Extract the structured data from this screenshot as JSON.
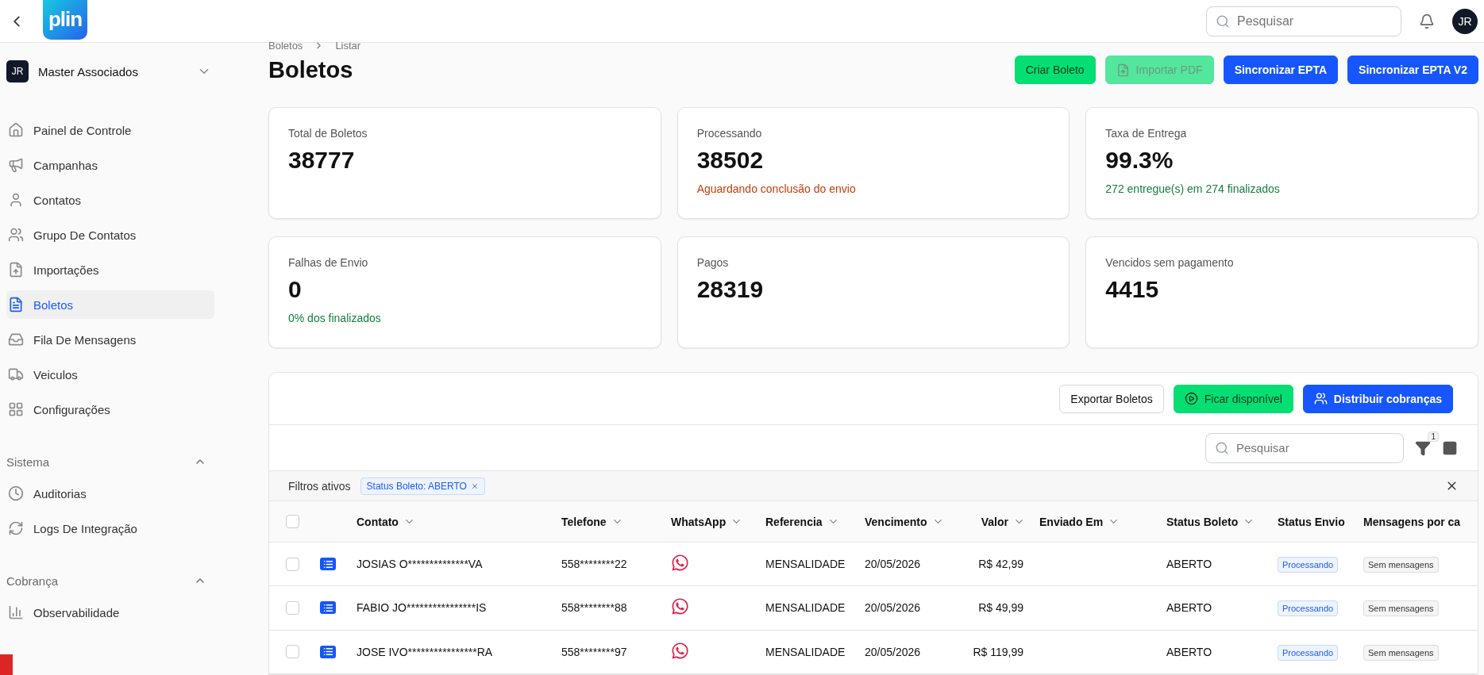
{
  "header": {
    "logo": "plin",
    "search": {
      "placeholder": "Pesquisar"
    },
    "avatar": "JR"
  },
  "sidebar": {
    "org": {
      "initials": "JR",
      "name": "Master Associados"
    },
    "items": [
      {
        "label": "Painel de Controle",
        "selected": false
      },
      {
        "label": "Campanhas",
        "selected": false
      },
      {
        "label": "Contatos",
        "selected": false
      },
      {
        "label": "Grupo De Contatos",
        "selected": false
      },
      {
        "label": "Importações",
        "selected": false
      },
      {
        "label": "Boletos",
        "selected": true
      },
      {
        "label": "Fila De Mensagens",
        "selected": false
      },
      {
        "label": "Veiculos",
        "selected": false
      },
      {
        "label": "Configurações",
        "selected": false
      }
    ],
    "sections": [
      {
        "title": "Sistema",
        "expanded": true,
        "items": [
          {
            "label": "Auditorias",
            "selected": false
          },
          {
            "label": "Logs De Integração",
            "selected": false
          }
        ]
      },
      {
        "title": "Cobrança",
        "expanded": true,
        "items": [
          {
            "label": "Observabilidade",
            "selected": false
          }
        ]
      }
    ]
  },
  "page": {
    "breadcrumb": [
      "Boletos",
      "Listar"
    ],
    "title": "Boletos",
    "actions": [
      {
        "label": "Criar Boleto",
        "kind": "green",
        "disabled": false
      },
      {
        "label": "Importar PDF",
        "kind": "green",
        "disabled": true
      },
      {
        "label": "Sincronizar EPTA",
        "kind": "blue",
        "disabled": false
      },
      {
        "label": "Sincronizar EPTA V2",
        "kind": "blue",
        "disabled": false
      }
    ]
  },
  "stats": [
    {
      "label": "Total de Boletos",
      "value": "38777"
    },
    {
      "label": "Processando",
      "value": "38502",
      "note": "Aguardando conclusão do envio",
      "kind": "warning"
    },
    {
      "label": "Taxa de Entrega",
      "value": "99.3%",
      "note": "272 entregue(s) em 274 finalizados",
      "kind": "success"
    },
    {
      "label": "Falhas de Envio",
      "value": "0",
      "note": "0% dos finalizados",
      "kind": "success"
    },
    {
      "label": "Pagos",
      "value": "28319"
    },
    {
      "label": "Vencidos sem pagamento",
      "value": "4415"
    }
  ],
  "table": {
    "actions": [
      {
        "label": "Exportar Boletos",
        "kind": "outline"
      },
      {
        "label": "Ficar disponível",
        "kind": "green"
      },
      {
        "label": "Distribuir cobranças",
        "kind": "blue"
      }
    ],
    "search": {
      "placeholder": "Pesquisar"
    },
    "filter_count": "1",
    "active_filters": {
      "label": "Filtros ativos",
      "chips": [
        "Status Boleto: ABERTO"
      ]
    },
    "select_all": {
      "checked": false
    },
    "columns": [
      {
        "label": "Contato",
        "sortable": true
      },
      {
        "label": "Telefone",
        "sortable": true
      },
      {
        "label": "WhatsApp",
        "sortable": true
      },
      {
        "label": "Referencia",
        "sortable": true
      },
      {
        "label": "Vencimento",
        "sortable": true
      },
      {
        "label": "Valor",
        "sortable": true
      },
      {
        "label": "Enviado Em",
        "sortable": true
      },
      {
        "label": "Status Boleto",
        "sortable": true
      },
      {
        "label": "Status Envio",
        "sortable": false
      },
      {
        "label": "Mensagens por ca",
        "sortable": false
      }
    ],
    "rows": [
      {
        "checked": false,
        "contato": "JOSIAS O**************VA",
        "telefone": "558********22",
        "referencia": "MENSALIDADE",
        "vencimento": "20/05/2026",
        "valor": "R$ 42,99",
        "status_boleto": "ABERTO",
        "status_envio": "Processando",
        "mensagens": "Sem mensagens"
      },
      {
        "checked": false,
        "contato": "FABIO JO****************IS",
        "telefone": "558********88",
        "referencia": "MENSALIDADE",
        "vencimento": "20/05/2026",
        "valor": "R$ 49,99",
        "status_boleto": "ABERTO",
        "status_envio": "Processando",
        "mensagens": "Sem mensagens"
      },
      {
        "checked": false,
        "contato": "JOSE IVO****************RA",
        "telefone": "558********97",
        "referencia": "MENSALIDADE",
        "vencimento": "20/05/2026",
        "valor": "R$ 119,99",
        "status_boleto": "ABERTO",
        "status_envio": "Processando",
        "mensagens": "Sem mensagens"
      }
    ]
  }
}
